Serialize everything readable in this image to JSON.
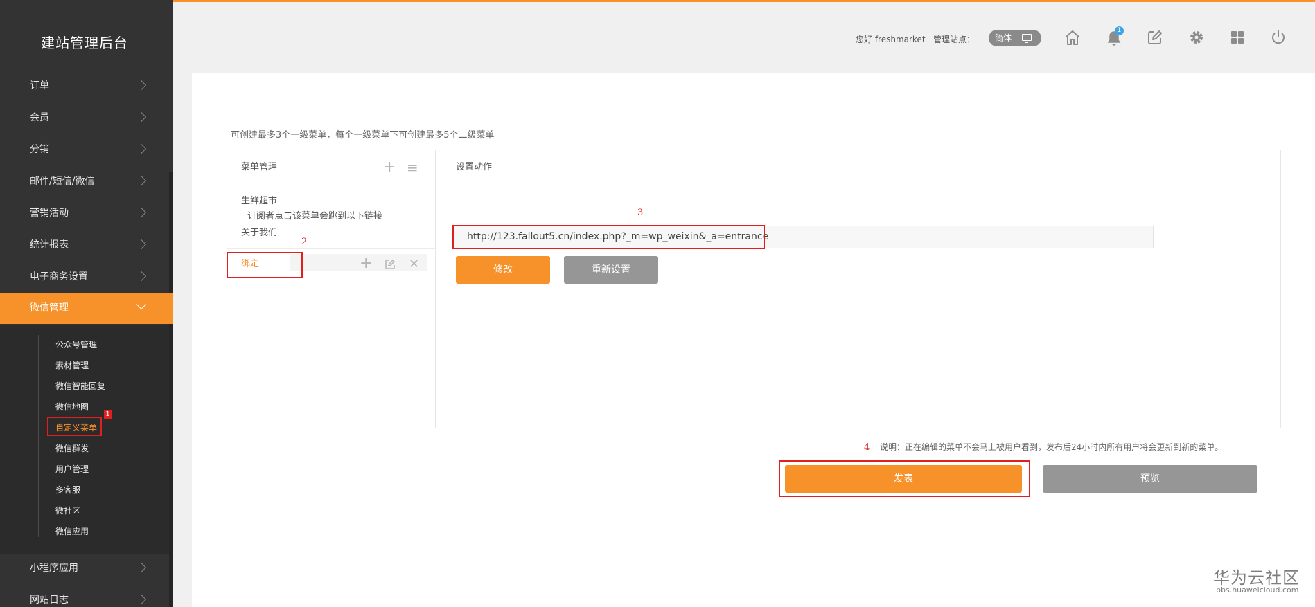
{
  "brand": {
    "title": "建站管理后台"
  },
  "sidebar": {
    "items": [
      {
        "label": "订单"
      },
      {
        "label": "会员"
      },
      {
        "label": "分销"
      },
      {
        "label": "邮件/短信/微信"
      },
      {
        "label": "营销活动"
      },
      {
        "label": "统计报表"
      },
      {
        "label": "电子商务设置"
      },
      {
        "label": "微信管理"
      },
      {
        "label": "小程序应用"
      },
      {
        "label": "网站日志"
      }
    ],
    "sub_items": [
      {
        "label": "公众号管理"
      },
      {
        "label": "素材管理"
      },
      {
        "label": "微信智能回复"
      },
      {
        "label": "微信地图"
      },
      {
        "label": "自定义菜单"
      },
      {
        "label": "微信群发"
      },
      {
        "label": "用户管理"
      },
      {
        "label": "多客服"
      },
      {
        "label": "微社区"
      },
      {
        "label": "微信应用"
      }
    ],
    "active_item": "微信管理",
    "current_sub_item": "自定义菜单"
  },
  "header": {
    "greeting": "您好 freshmarket",
    "site_label": "管理站点：",
    "language": "简体",
    "notification_count": "1",
    "icons": [
      "home-icon",
      "bell-icon",
      "edit-icon",
      "gear-icon",
      "grid-icon",
      "power-icon"
    ]
  },
  "main": {
    "hint": "可创建最多3个一级菜单，每个一级菜单下可创建最多5个二级菜单。",
    "menu_panel": {
      "title": "菜单管理",
      "items": [
        {
          "label": "生鲜超市"
        },
        {
          "label": "关于我们"
        },
        {
          "label": "绑定"
        }
      ]
    },
    "action_panel": {
      "title": "设置动作",
      "link_label": "订阅者点击该菜单会跳到以下链接",
      "url": "http://123.fallout5.cn/index.php?_m=wp_weixin&_a=entrance",
      "modify_label": "修改",
      "reset_label": "重新设置"
    },
    "note": "说明：正在编辑的菜单不会马上被用户看到，发布后24小时内所有用户将会更新到新的菜单。",
    "publish_label": "发表",
    "preview_label": "预览"
  },
  "annotations": [
    "1",
    "2",
    "3",
    "4"
  ],
  "watermark": {
    "main": "华为云社区",
    "sub": "bbs.huaweicloud.com"
  },
  "colors": {
    "accent": "#f7922a",
    "sidebar": "#333333",
    "annotation": "#e01f1f",
    "gray_button": "#969696"
  }
}
